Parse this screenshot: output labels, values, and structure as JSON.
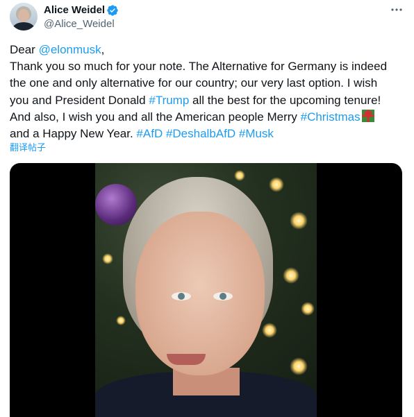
{
  "author": {
    "name": "Alice Weidel",
    "handle": "@Alice_Weidel",
    "verified_color": "#1d9bf0"
  },
  "post": {
    "lines": [
      [
        {
          "t": "Dear "
        },
        {
          "t": "@elonmusk",
          "link": true
        },
        {
          "t": ","
        }
      ],
      [
        {
          "t": "Thank you so much for your note. The Alternative for Germany is indeed"
        }
      ],
      [
        {
          "t": "the one and only alternative for our country; our very last option. I wish"
        }
      ],
      [
        {
          "t": "you and President Donald "
        },
        {
          "t": "#Trump",
          "link": true
        },
        {
          "t": " all the best for the upcoming tenure!"
        }
      ],
      [
        {
          "t": "And also, I wish you and all the American people Merry "
        },
        {
          "t": "#Christmas",
          "link": true
        },
        {
          "icon": "gift-emoji"
        }
      ],
      [
        {
          "t": "and a Happy New Year. "
        },
        {
          "t": "#AfD",
          "link": true
        },
        {
          "t": " "
        },
        {
          "t": "#DeshalbAfD",
          "link": true
        },
        {
          "t": " "
        },
        {
          "t": "#Musk",
          "link": true
        }
      ]
    ],
    "translate_label": "翻译帖子"
  },
  "icons": {
    "more": "more-options-icon",
    "verified": "verified-badge-icon",
    "gift": "gift-emoji"
  },
  "colors": {
    "link": "#1d9bf0",
    "text": "#0f1419",
    "secondary": "#536471"
  }
}
